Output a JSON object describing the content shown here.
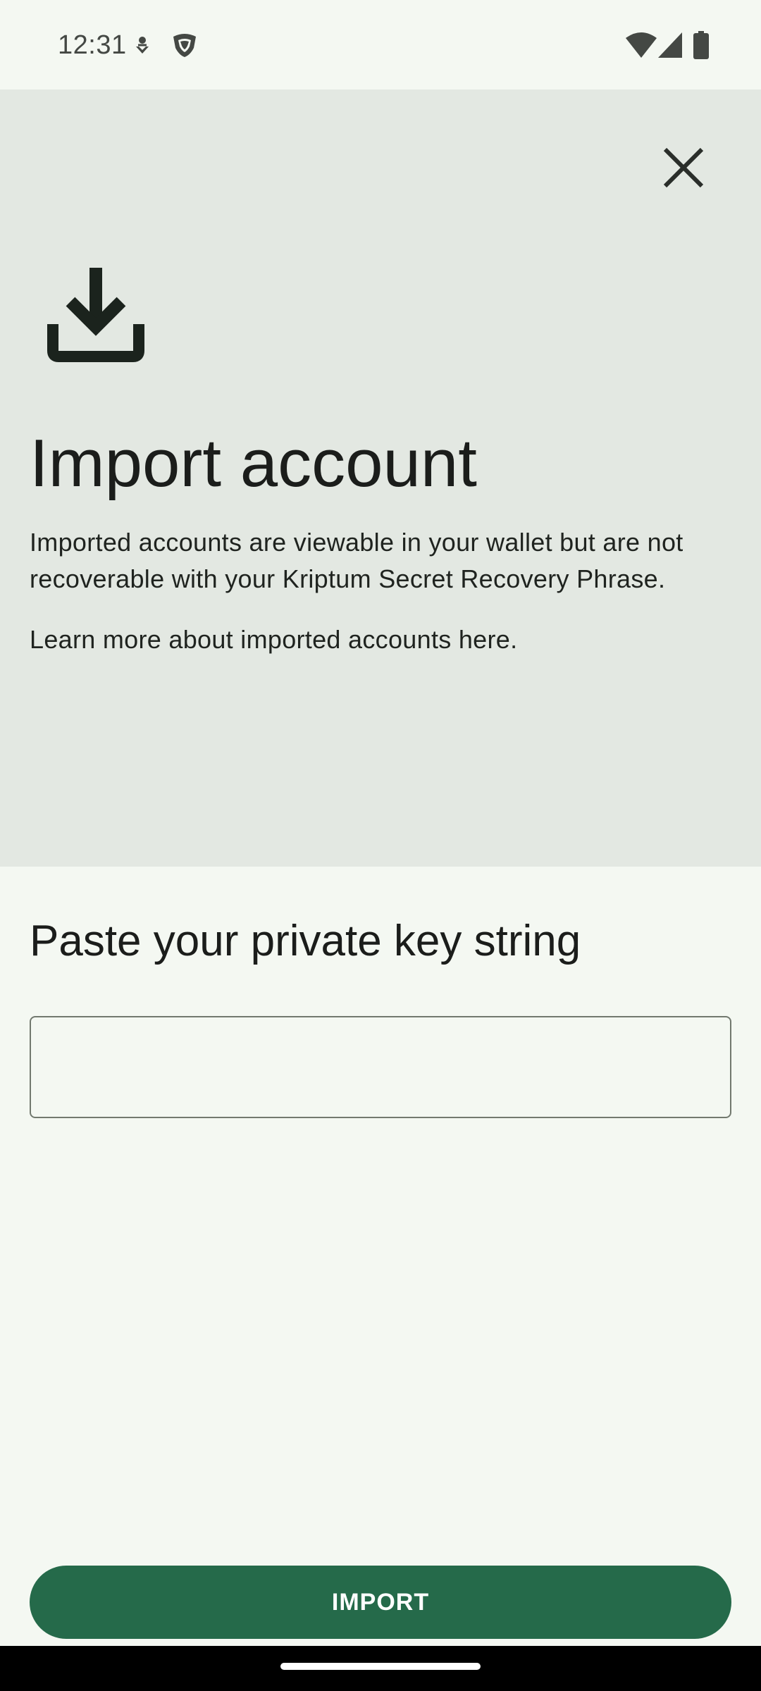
{
  "status_bar": {
    "time": "12:31",
    "icons": [
      "notification-small-icon",
      "shield-app-icon",
      "wifi-icon",
      "signal-icon",
      "battery-icon"
    ]
  },
  "header": {
    "close_icon": "close-icon",
    "illustration_icon": "download-icon",
    "title": "Import account",
    "description": "Imported accounts are viewable in your wallet but are not recoverable with your Kriptum Secret Recovery Phrase.",
    "learn_more": "Learn more about imported accounts here."
  },
  "form": {
    "label": "Paste your private key string",
    "input_value": "",
    "input_placeholder": ""
  },
  "actions": {
    "import_label": "IMPORT"
  },
  "colors": {
    "background": "#f4f8f2",
    "hero_background": "#e3e8e2",
    "primary_button": "#256a4a",
    "text": "#1b1d1b",
    "input_border": "#72796f"
  }
}
